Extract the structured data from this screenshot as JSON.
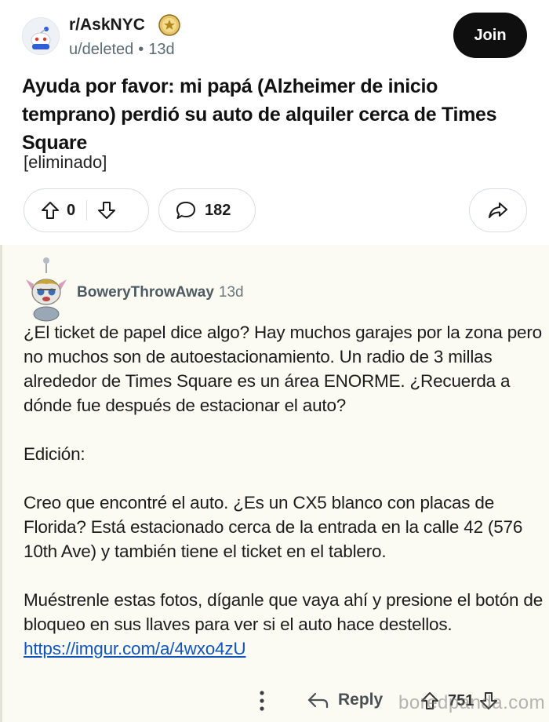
{
  "post": {
    "subreddit": "r/AskNYC",
    "author": "u/deleted",
    "age": "13d",
    "join_label": "Join",
    "title": "Ayuda por favor: mi papá (Alzheimer de inicio temprano) perdió su auto de alquiler cerca de Times Square",
    "body": "[eliminado]",
    "score": "0",
    "comment_count": "182",
    "icons": {
      "subreddit": "snoo-avatar-icon",
      "award": "award-icon",
      "upvote": "upvote-arrow-icon",
      "downvote": "downvote-arrow-icon",
      "comment": "comment-bubble-icon",
      "share": "share-arrow-icon"
    }
  },
  "comment": {
    "author": "BoweryThrowAway",
    "age": "13d",
    "paragraph1": "¿El ticket de papel dice algo? Hay muchos garajes por la zona pero no muchos son de autoestacionamiento. Un radio de 3 millas alrededor de Times Square es un área ENORME. ¿Recuerda a dónde fue después de estacionar el auto?",
    "paragraph2": "Edición:",
    "paragraph3": "Creo que encontré el auto. ¿Es un CX5 blanco con placas de Florida? Está estacionado cerca de la entrada en la calle 42 (576 10th Ave) y también tiene el ticket en el tablero.",
    "paragraph4": "Muéstrenle estas fotos, díganle que vaya ahí y presione el botón de bloqueo en sus llaves para ver si el auto hace destellos.",
    "link": "https://imgur.com/a/4wxo4zU",
    "reply_label": "Reply",
    "score": "751",
    "icons": {
      "avatar": "user-avatar-icon",
      "more": "more-options-icon",
      "reply": "reply-arrow-icon",
      "upvote": "upvote-arrow-icon",
      "downvote": "downvote-arrow-icon"
    }
  },
  "watermark": "boredpanda.com",
  "colors": {
    "join_bg": "#0f0f0f",
    "link": "#1155bb",
    "comment_bg": "#fbfbf4"
  }
}
